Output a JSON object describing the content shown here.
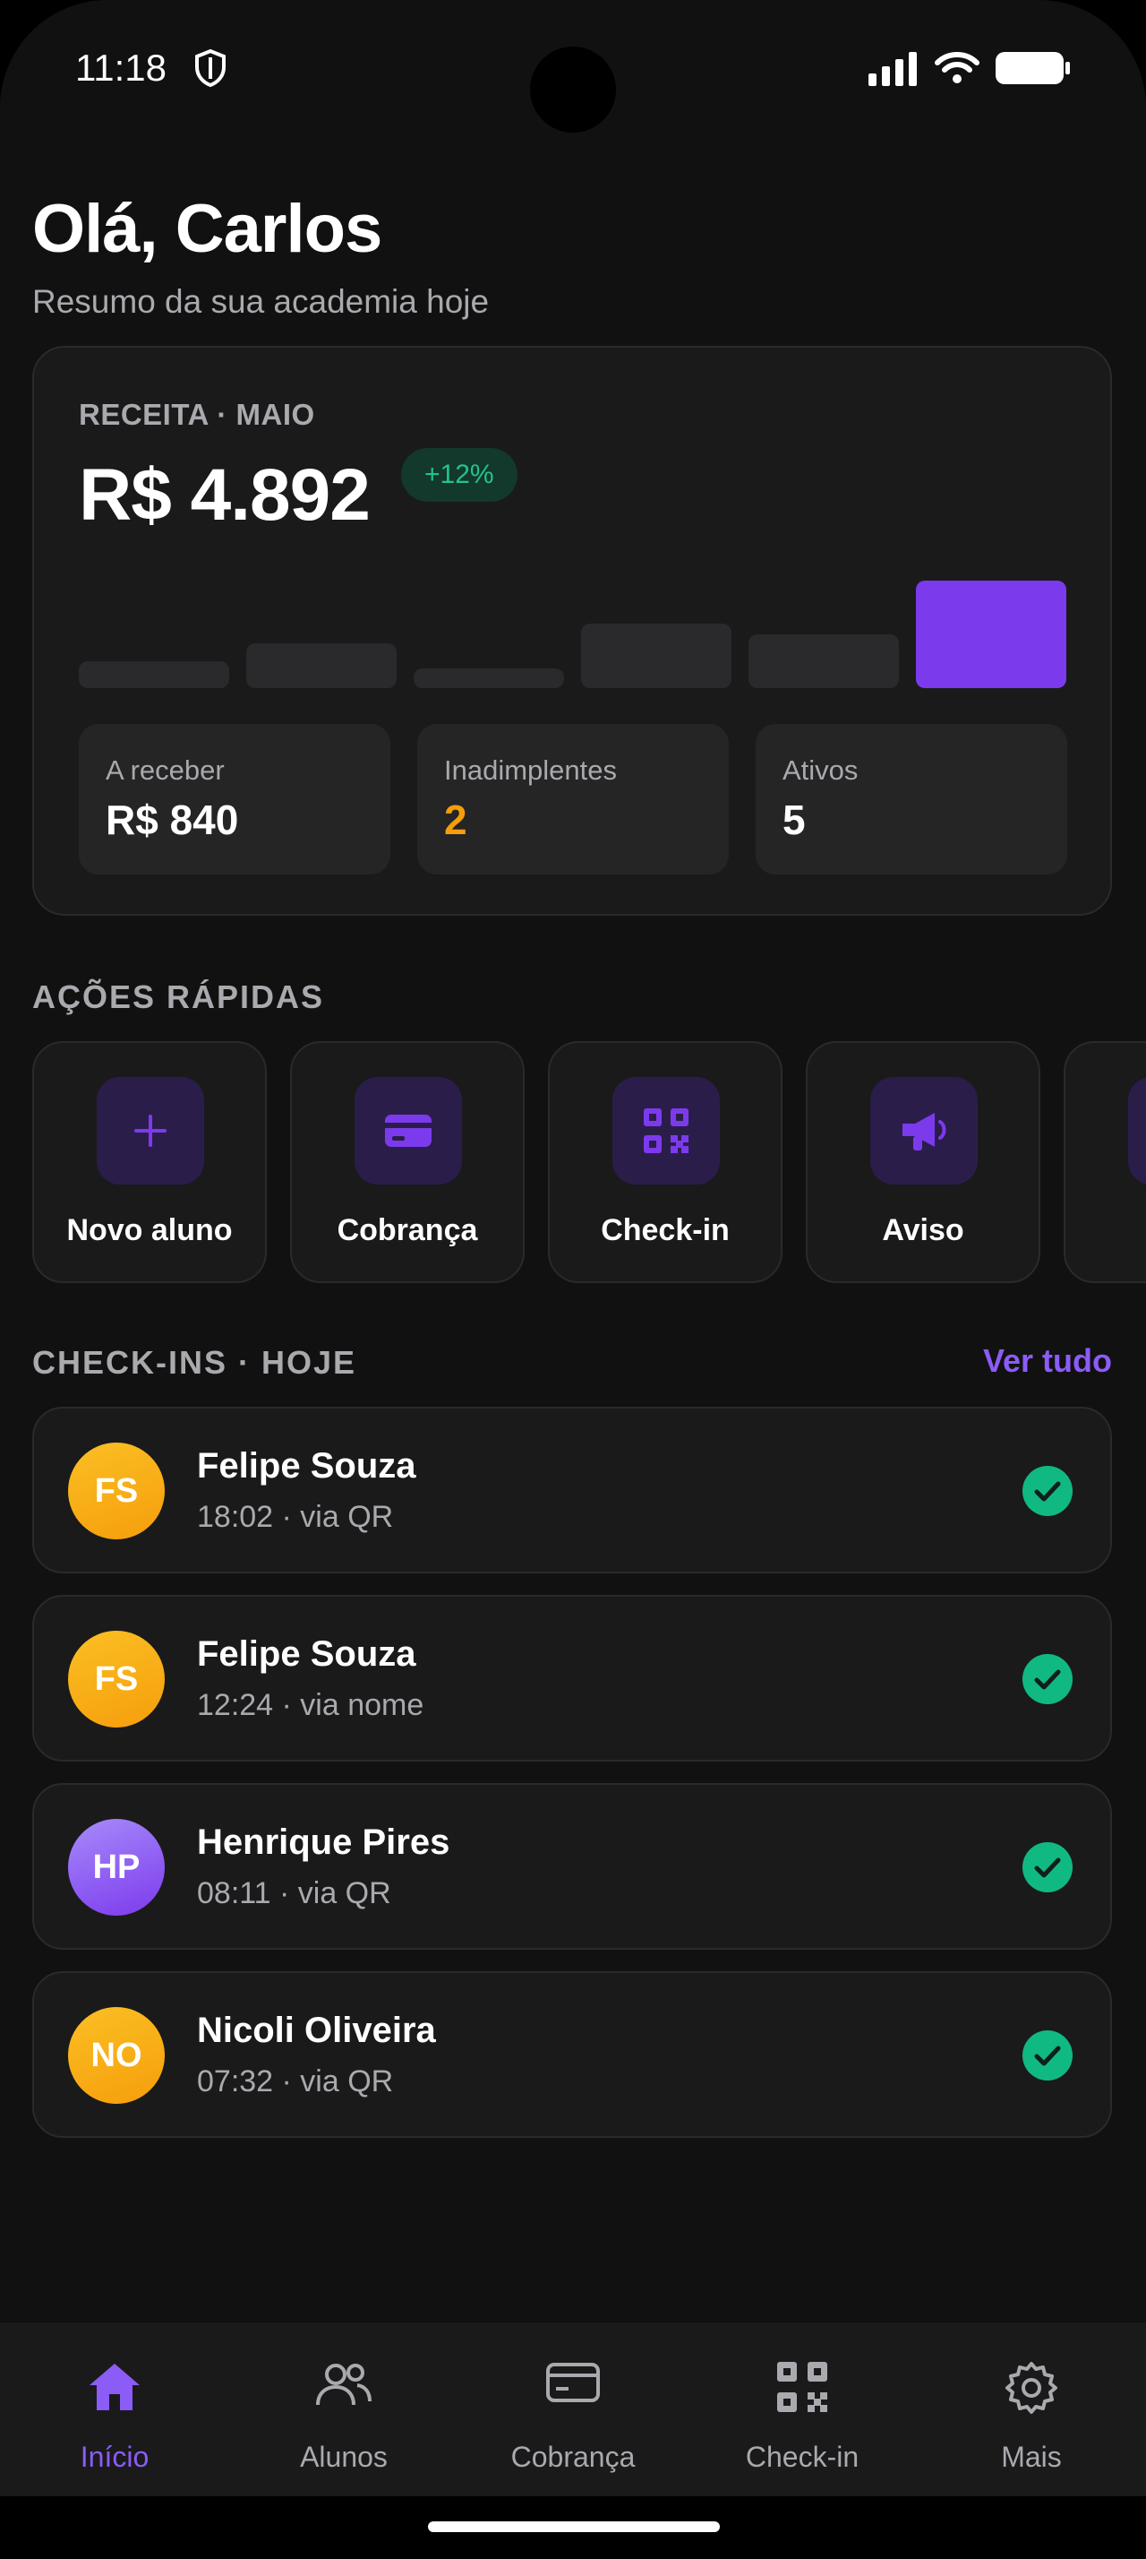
{
  "status_bar": {
    "time": "11:18"
  },
  "header": {
    "greeting": "Olá, Carlos",
    "subtitle": "Resumo da sua academia hoje"
  },
  "revenue": {
    "label": "RECEITA · MAIO",
    "amount": "R$ 4.892",
    "change_badge": "+12%",
    "accent_color": "#7c3aed",
    "stats": [
      {
        "label": "A receber",
        "value": "R$ 840",
        "color": "#ffffff"
      },
      {
        "label": "Inadimplentes",
        "value": "2",
        "color": "#f59e0b"
      },
      {
        "label": "Ativos",
        "value": "5",
        "color": "#ffffff"
      }
    ]
  },
  "quick_actions": {
    "title": "AÇÕES RÁPIDAS",
    "items": [
      {
        "label": "Novo aluno",
        "icon": "plus-icon"
      },
      {
        "label": "Cobrança",
        "icon": "card-icon"
      },
      {
        "label": "Check-in",
        "icon": "qr-code-icon"
      },
      {
        "label": "Aviso",
        "icon": "megaphone-icon"
      }
    ]
  },
  "checkins": {
    "title": "CHECK-INS · HOJE",
    "see_all": "Ver tudo",
    "items": [
      {
        "initials": "FS",
        "name": "Felipe Souza",
        "meta": "18:02 · via QR",
        "avatar_color": "yellow"
      },
      {
        "initials": "FS",
        "name": "Felipe Souza",
        "meta": "12:24 · via nome",
        "avatar_color": "yellow"
      },
      {
        "initials": "HP",
        "name": "Henrique Pires",
        "meta": "08:11 · via QR",
        "avatar_color": "purple"
      },
      {
        "initials": "NO",
        "name": "Nicoli Oliveira",
        "meta": "07:32 · via QR",
        "avatar_color": "yellow"
      }
    ]
  },
  "bottom_nav": {
    "items": [
      {
        "label": "Início",
        "icon": "home-icon",
        "active": true
      },
      {
        "label": "Alunos",
        "icon": "users-icon",
        "active": false
      },
      {
        "label": "Cobrança",
        "icon": "card-icon",
        "active": false
      },
      {
        "label": "Check-in",
        "icon": "qr-code-icon",
        "active": false
      },
      {
        "label": "Mais",
        "icon": "gear-icon",
        "active": false
      }
    ]
  }
}
